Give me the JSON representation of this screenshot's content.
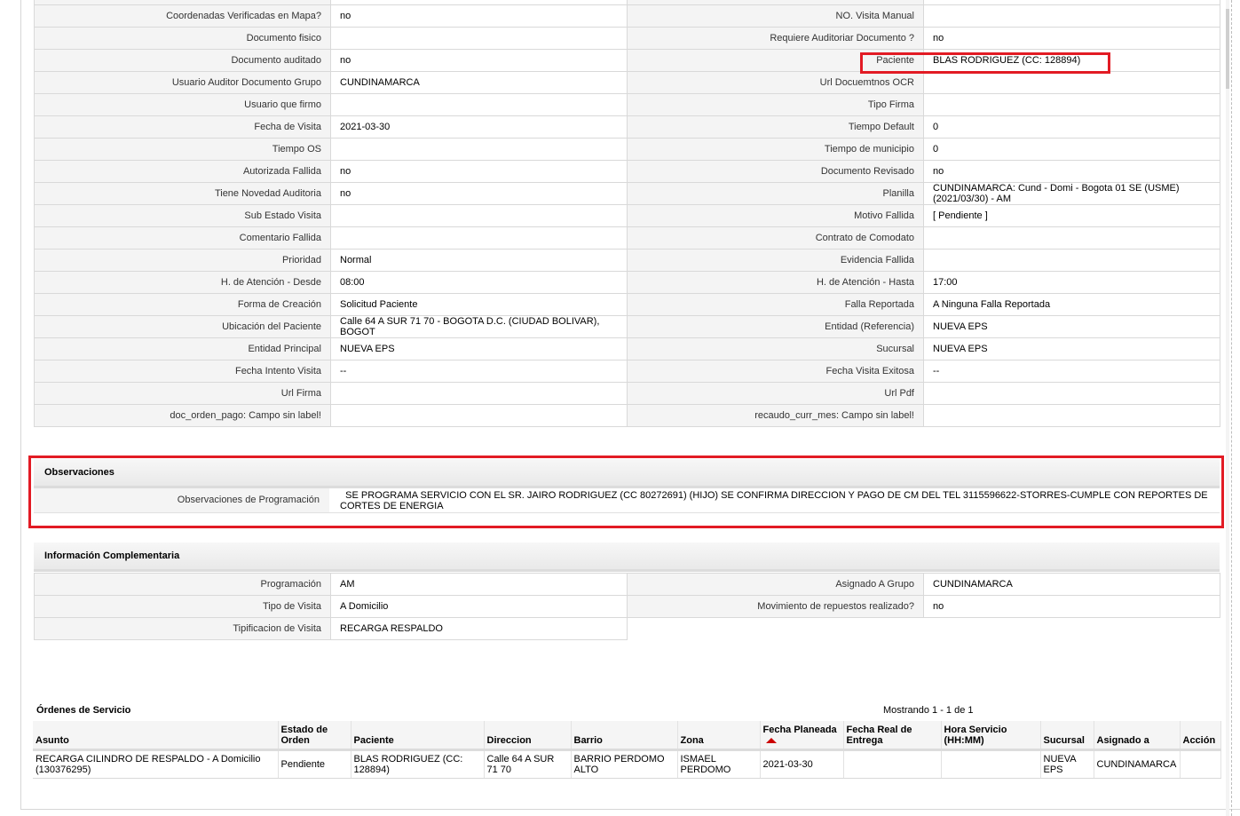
{
  "detail_rows": [
    {
      "l1": "Coordenadas Verificadas en Mapa?",
      "v1": "no",
      "l2": "NO. Visita Manual",
      "v2": ""
    },
    {
      "l1": "Documento fisico",
      "v1": "",
      "l2": "Requiere Auditoriar Documento ?",
      "v2": "no"
    },
    {
      "l1": "Documento auditado",
      "v1": "no",
      "l2": "Paciente",
      "v2": "BLAS RODRIGUEZ (CC: 128894)"
    },
    {
      "l1": "Usuario Auditor Documento Grupo",
      "v1": "CUNDINAMARCA",
      "l2": "Url Docuemtnos OCR",
      "v2": ""
    },
    {
      "l1": "Usuario que firmo",
      "v1": "",
      "l2": "Tipo Firma",
      "v2": ""
    },
    {
      "l1": "Fecha de Visita",
      "v1": " 2021-03-30",
      "l2": "Tiempo Default",
      "v2": "0"
    },
    {
      "l1": "Tiempo OS",
      "v1": "",
      "l2": "Tiempo de municipio",
      "v2": "0"
    },
    {
      "l1": "Autorizada Fallida",
      "v1": "no",
      "l2": "Documento Revisado",
      "v2": "no"
    },
    {
      "l1": "Tiene Novedad Auditoria",
      "v1": "no",
      "l2": "Planilla",
      "v2": "CUNDINAMARCA: Cund - Domi - Bogota 01 SE (USME) (2021/03/30) - AM"
    },
    {
      "l1": "Sub Estado Visita",
      "v1": "",
      "l2": "Motivo Fallida",
      "v2": "[ Pendiente ]"
    },
    {
      "l1": "Comentario Fallida",
      "v1": "",
      "l2": "Contrato de Comodato",
      "v2": ""
    },
    {
      "l1": "Prioridad",
      "v1": "Normal",
      "l2": "Evidencia Fallida",
      "v2": ""
    },
    {
      "l1": "H. de Atención - Desde",
      "v1": "08:00",
      "l2": "H. de Atención - Hasta",
      "v2": "17:00"
    },
    {
      "l1": "Forma de Creación",
      "v1": "Solicitud Paciente",
      "l2": "Falla Reportada",
      "v2": "A Ninguna Falla Reportada"
    },
    {
      "l1": "Ubicación del Paciente",
      "v1": "Calle 64 A SUR 71 70 - BOGOTA D.C. (CIUDAD BOLIVAR), BOGOT",
      "l2": "Entidad (Referencia)",
      "v2": "NUEVA EPS"
    },
    {
      "l1": "Entidad Principal",
      "v1": "NUEVA EPS",
      "l2": "Sucursal",
      "v2": "NUEVA EPS"
    },
    {
      "l1": "Fecha Intento Visita",
      "v1": "--",
      "l2": "Fecha Visita Exitosa",
      "v2": "--"
    },
    {
      "l1": "Url Firma",
      "v1": "",
      "l2": "Url Pdf",
      "v2": ""
    },
    {
      "l1": "doc_orden_pago: Campo sin label!",
      "v1": "",
      "l2": "recaudo_curr_mes: Campo sin label!",
      "v2": ""
    }
  ],
  "observaciones": {
    "title": "Observaciones",
    "label": "Observaciones de Programación",
    "value": "  SE PROGRAMA SERVICIO CON EL SR. JAIRO RODRIGUEZ (CC 80272691) (HIJO) SE CONFIRMA DIRECCION Y PAGO DE CM DEL TEL 3115596622-STORRES-CUMPLE CON REPORTES DE CORTES DE ENERGIA"
  },
  "info_comp": {
    "title": "Información Complementaria",
    "rows": [
      {
        "l1": "Programación",
        "v1": "AM",
        "l2": "Asignado A Grupo",
        "v2": "CUNDINAMARCA"
      },
      {
        "l1": "Tipo de Visita",
        "v1": "A Domicilio",
        "l2": "Movimiento de repuestos realizado?",
        "v2": "no"
      },
      {
        "l1": "Tipificacion de Visita",
        "v1": "RECARGA RESPALDO"
      }
    ]
  },
  "orders": {
    "title": "Órdenes de Servicio",
    "showing": "Mostrando 1 - 1 de 1",
    "columns": [
      "Asunto",
      "Estado de Orden",
      "Paciente",
      "Direccion",
      "Barrio",
      "Zona",
      "Fecha Planeada",
      "Fecha Real de Entrega",
      "Hora Servicio (HH:MM)",
      "Sucursal",
      "Asignado a",
      "Acción"
    ],
    "rows": [
      [
        "RECARGA CILINDRO DE RESPALDO - A Domicilio (130376295)",
        "Pendiente",
        "BLAS RODRIGUEZ (CC: 128894)",
        "Calle 64 A SUR 71 70",
        "BARRIO PERDOMO ALTO",
        "ISMAEL PERDOMO",
        "2021-03-30",
        "",
        "",
        "NUEVA EPS",
        "CUNDINAMARCA",
        ""
      ]
    ],
    "sort_icon": "sort-ascending-icon"
  },
  "highlight_color": "#e21b24"
}
